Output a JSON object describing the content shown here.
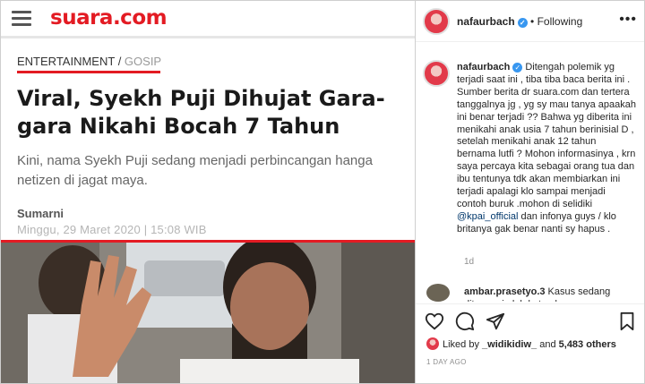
{
  "article": {
    "brand": "suara.com",
    "category": "ENTERTAINMENT",
    "category_separator": " / ",
    "subcategory": "GOSIP",
    "headline": "Viral, Syekh Puji Dihujat Gara-gara Nikahi Bocah 7 Tahun",
    "lede": "Kini, nama Syekh Puji sedang menjadi perbincangan hanga netizen di jagat maya.",
    "author": "Sumarni",
    "date": "Minggu, 29 Maret 2020 | 15:08 WIB",
    "icons": {
      "menu": "hamburger-menu-icon"
    },
    "colors": {
      "brand": "#e31b23"
    }
  },
  "instagram": {
    "header": {
      "username": "nafaurbach",
      "separator": " • ",
      "follow_label": "Following"
    },
    "caption": {
      "username": "nafaurbach",
      "text_part1": " Ditengah polemik yg terjadi saat ini , tiba tiba baca berita ini . Sumber berita dr suara.com dan tertera tanggalnya jg , yg sy mau tanya apaakah ini benar terjadi ?? Bahwa yg diberita ini menikahi anak usia 7 tahun berinisial D , setelah menikahi anak 12 tahun bernama lutfi ? Mohon informasinya , krn saya percaya kita sebagai orang tua dan ibu tentunya tdk akan membiarkan ini terjadi apalagi klo sampai menjadi contoh buruk .mohon di selidiki ",
      "mention": "@kpai_official",
      "text_part2": " dan infonya guys / klo britanya gak benar nanti sy hapus .",
      "time": "1d"
    },
    "comment": {
      "username": "ambar.prasetyo.3",
      "text": " Kasus sedang ditangani oleh ketua komnas"
    },
    "likes": {
      "prefix": "Liked by ",
      "user": "_widikidiw_",
      "middle": " and ",
      "count": "5,483 others"
    },
    "posted": "1 DAY AGO",
    "icons": [
      "heart-icon",
      "comment-icon",
      "share-icon",
      "bookmark-icon",
      "more-options-icon",
      "verified-badge-icon"
    ],
    "colors": {
      "verified": "#3897f0",
      "mention": "#00376b"
    }
  }
}
